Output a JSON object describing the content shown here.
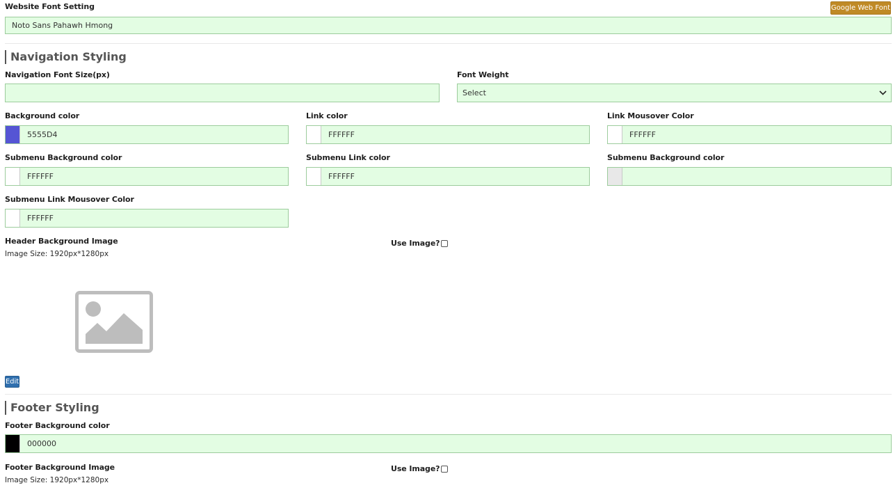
{
  "website_font": {
    "label": "Website Font Setting",
    "google_button": "Google Web Font",
    "value": "Noto Sans Pahawh Hmong"
  },
  "navigation": {
    "title": "Navigation Styling",
    "font_size_label": "Navigation Font Size(px)",
    "font_size_value": "",
    "font_weight_label": "Font Weight",
    "font_weight_value": "Select",
    "background_color": {
      "label": "Background color",
      "value": "5555D4",
      "swatch": "#5555D4"
    },
    "link_color": {
      "label": "Link color",
      "value": "FFFFFF",
      "swatch": "#FFFFFF"
    },
    "link_mouseover_color": {
      "label": "Link Mousover Color",
      "value": "FFFFFF",
      "swatch": "#FFFFFF"
    },
    "submenu_bg_color": {
      "label": "Submenu Background color",
      "value": "FFFFFF",
      "swatch": "#FFFFFF"
    },
    "submenu_link_color": {
      "label": "Submenu Link color",
      "value": "FFFFFF",
      "swatch": "#FFFFFF"
    },
    "submenu_bg_color_2": {
      "label": "Submenu Background color",
      "value": "",
      "swatch": "#E8E8E8"
    },
    "submenu_link_mouseover_color": {
      "label": "Submenu Link Mousover Color",
      "value": "FFFFFF",
      "swatch": "#FFFFFF"
    },
    "header_image_label": "Header Background Image",
    "header_image_size": "Image Size: 1920px*1280px",
    "use_image_label": "Use Image?",
    "use_image_checked": false,
    "edit_button": "Edit"
  },
  "footer": {
    "title": "Footer Styling",
    "background_color": {
      "label": "Footer Background color",
      "value": "000000",
      "swatch": "#000000"
    },
    "image_label": "Footer Background Image",
    "image_size": "Image Size: 1920px*1280px",
    "use_image_label": "Use Image?",
    "use_image_checked": false
  },
  "icons": {
    "placeholder_image": "image-placeholder-icon",
    "select_caret": "chevron-down-icon"
  },
  "colors": {
    "input_bg": "#E3FDE3",
    "google_button_bg": "#C08A26",
    "edit_button_bg": "#2F6FAE"
  }
}
